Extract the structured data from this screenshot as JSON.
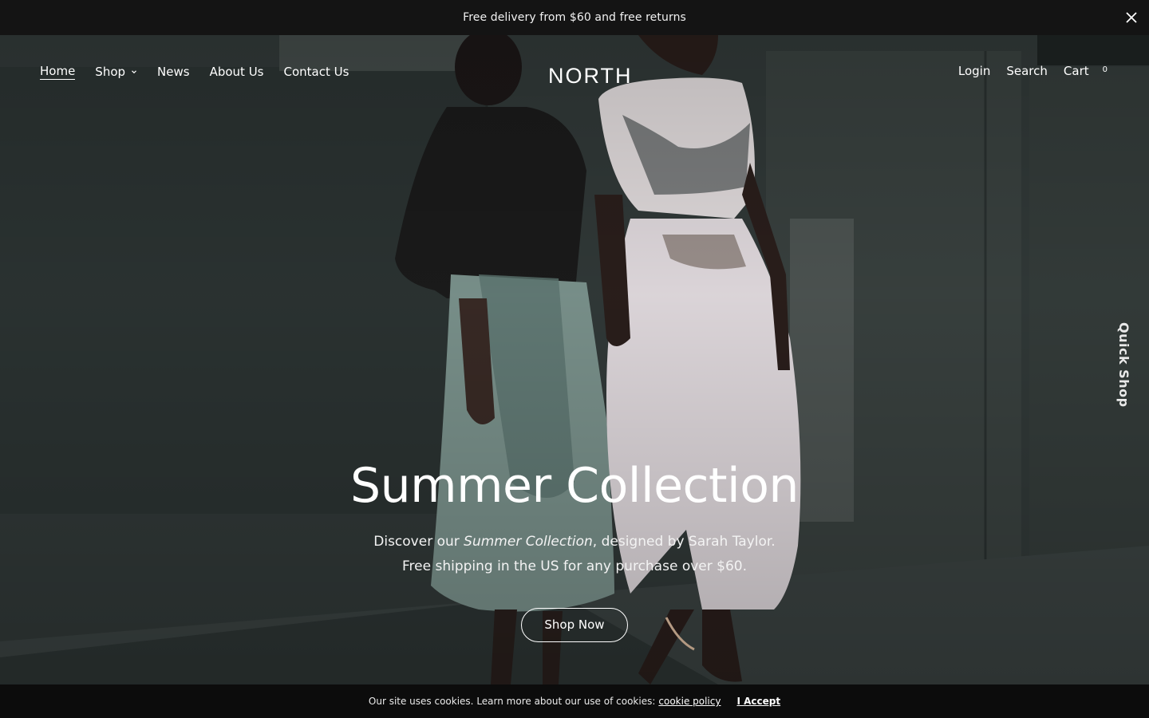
{
  "announcement": {
    "text": "Free delivery from $60 and free returns",
    "close_icon": "close-icon"
  },
  "header": {
    "logo": "NORTH",
    "nav_left": [
      {
        "label": "Home",
        "active": true
      },
      {
        "label": "Shop",
        "has_dropdown": true
      },
      {
        "label": "News"
      },
      {
        "label": "About Us"
      },
      {
        "label": "Contact Us"
      }
    ],
    "nav_right": {
      "login": "Login",
      "search": "Search",
      "cart": "Cart",
      "cart_count": "0"
    }
  },
  "hero": {
    "title": "Summer Collection",
    "desc_prefix": "Discover our ",
    "desc_emphasis": "Summer Collection",
    "desc_suffix": ", designed by Sarah Taylor.",
    "desc_line2": "Free shipping in the US for any purchase over $60.",
    "button": "Shop Now"
  },
  "quick_shop": "Quick Shop",
  "cookie": {
    "text": "Our site uses cookies. Learn more about our use of cookies:",
    "link": "cookie policy",
    "accept": "I Accept"
  }
}
